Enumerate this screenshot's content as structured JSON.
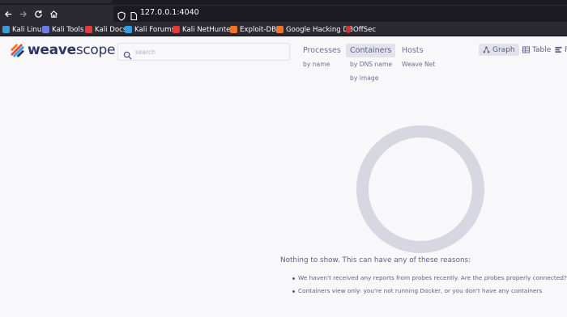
{
  "browser": {
    "url": "127.0.0.1:4040",
    "bookmarks": [
      {
        "label": "Kali Linux",
        "color": "#3a9bdc"
      },
      {
        "label": "Kali Tools",
        "color": "#6d7ddc"
      },
      {
        "label": "Kali Docs",
        "color": "#e23b3b"
      },
      {
        "label": "Kali Forums",
        "color": "#3a9bdc"
      },
      {
        "label": "Kali NetHunter",
        "color": "#e23b3b"
      },
      {
        "label": "Exploit-DB",
        "color": "#f0742a"
      },
      {
        "label": "Google Hacking DB",
        "color": "#f0742a"
      },
      {
        "label": "OffSec",
        "color": "#d0302f"
      }
    ]
  },
  "app": {
    "logo": {
      "bold": "weave",
      "light": "scope"
    },
    "search": {
      "placeholder": "search",
      "value": ""
    },
    "topologies": [
      {
        "label": "Processes",
        "active": false,
        "subs": [
          "by name"
        ]
      },
      {
        "label": "Containers",
        "active": true,
        "subs": [
          "by DNS name",
          "by image"
        ]
      },
      {
        "label": "Hosts",
        "active": false,
        "subs": [
          "Weave Net"
        ]
      }
    ],
    "views": [
      {
        "label": "Graph",
        "active": true,
        "icon": "graph-icon"
      },
      {
        "label": "Table",
        "active": false,
        "icon": "table-icon"
      },
      {
        "label": "R",
        "active": false,
        "icon": "resources-icon"
      }
    ],
    "empty": {
      "title": "Nothing to show. This can have any of these reasons:",
      "reasons": [
        "We haven't received any reports from probes recently. Are the probes properly connected?",
        "Containers view only: you're not running Docker, or you don't have any containers"
      ]
    },
    "colors": {
      "brand": "#2e3560",
      "accent": "#f0742a",
      "ring": "#d6d7e1"
    }
  }
}
